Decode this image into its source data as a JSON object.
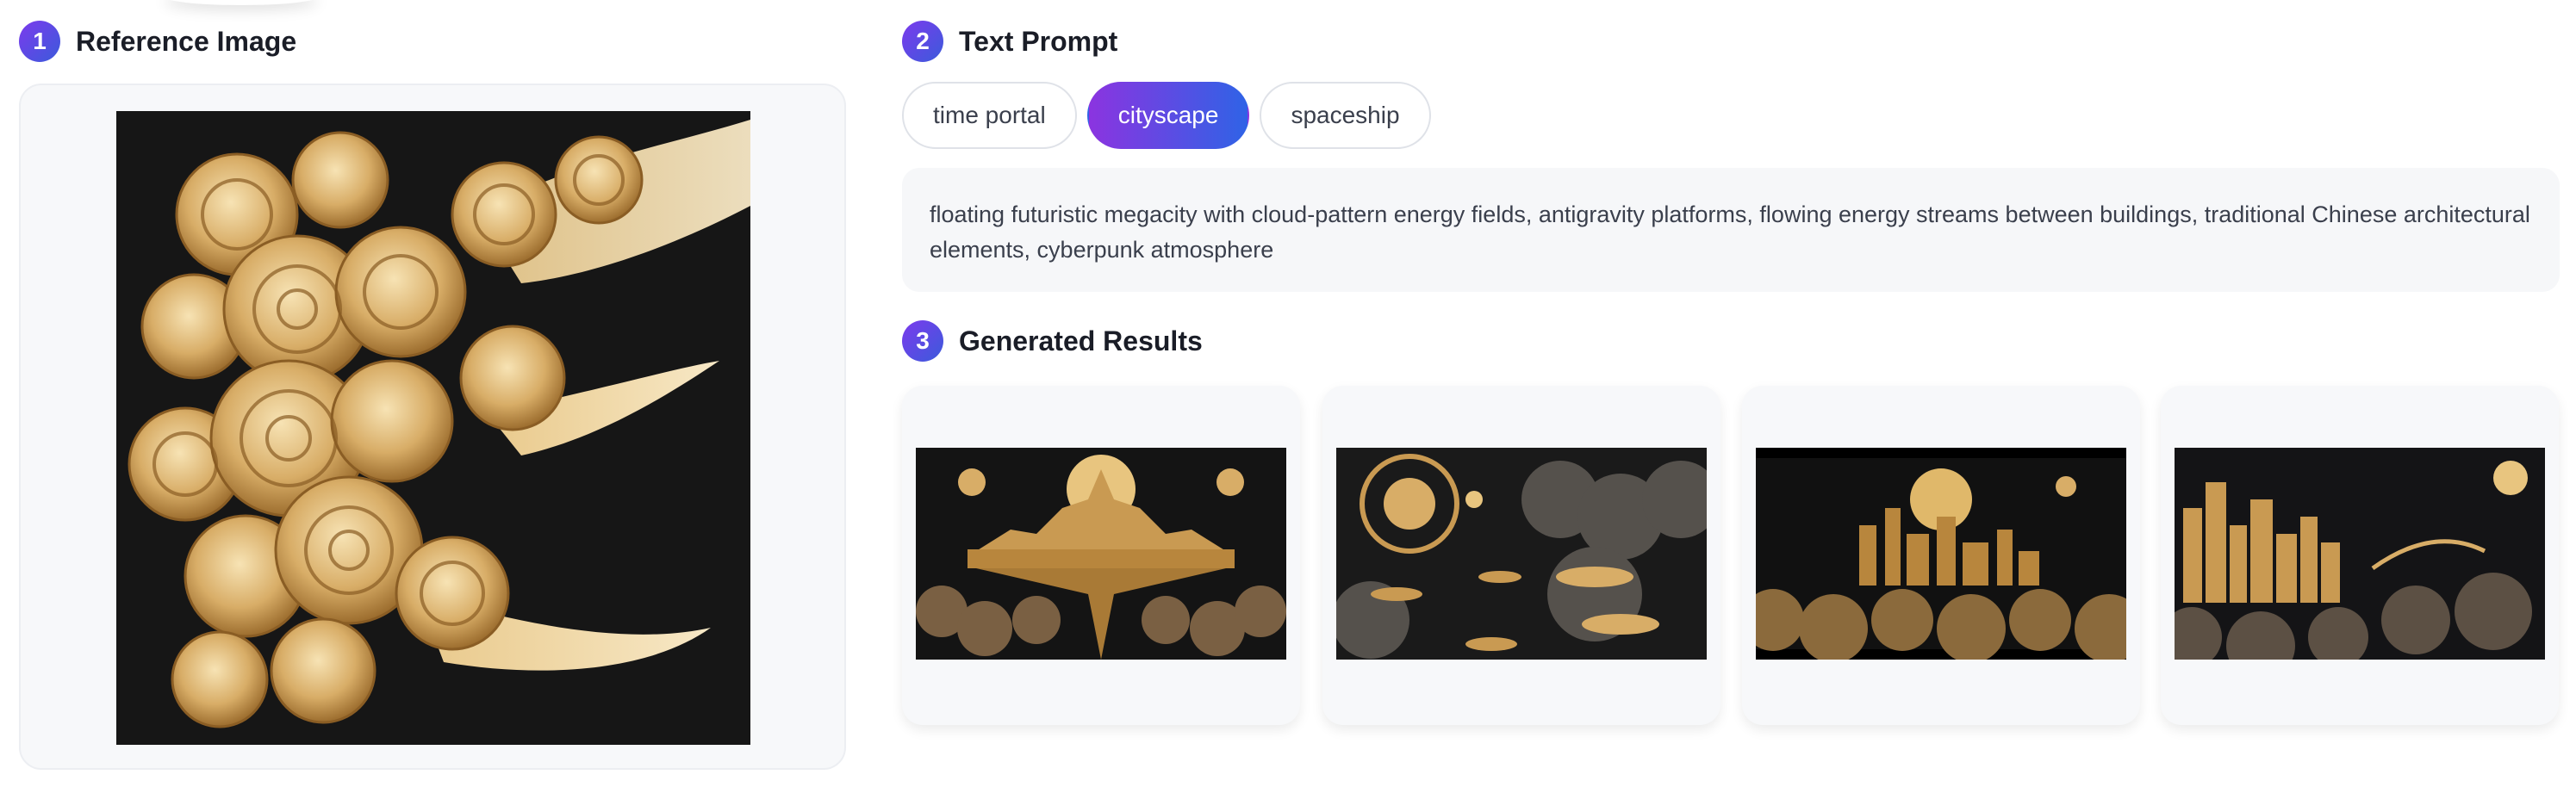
{
  "reference": {
    "step": "1",
    "title": "Reference Image",
    "image_icon": "golden-swirl-clouds-image"
  },
  "prompt_section": {
    "step": "2",
    "title": "Text Prompt",
    "tabs": [
      {
        "label": "time portal",
        "active": false
      },
      {
        "label": "cityscape",
        "active": true
      },
      {
        "label": "spaceship",
        "active": false
      }
    ],
    "prompt_text": "floating futuristic megacity with cloud-pattern energy fields, antigravity platforms, flowing energy streams between buildings, traditional Chinese architectural elements, cyberpunk atmosphere"
  },
  "results": {
    "step": "3",
    "title": "Generated Results",
    "images": [
      {
        "name": "result-1",
        "description_icon": "golden-floating-palace-image"
      },
      {
        "name": "result-2",
        "description_icon": "golden-portal-platforms-image"
      },
      {
        "name": "result-3",
        "description_icon": "golden-city-moon-image"
      },
      {
        "name": "result-4",
        "description_icon": "golden-skyline-bridge-image"
      }
    ]
  },
  "colors": {
    "accent_start": "#8b34e0",
    "accent_end": "#2f63e6",
    "gold": "#d9b26a"
  }
}
